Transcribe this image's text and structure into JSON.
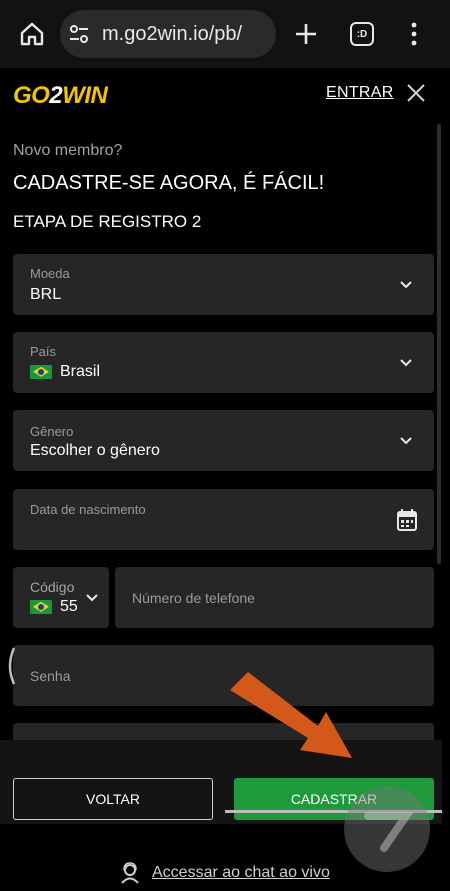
{
  "browser": {
    "url": "m.go2win.io/pb/",
    "tabs_label": ":D"
  },
  "header": {
    "logo_part1": "GO",
    "logo_part2": "2",
    "logo_part3": "WIN",
    "login_label": "ENTRAR"
  },
  "form": {
    "new_member": "Novo membro?",
    "signup_title": "CADASTRE-SE AGORA, É FÁCIL!",
    "step_title": "ETAPA DE REGISTRO 2",
    "currency": {
      "label": "Moeda",
      "value": "BRL"
    },
    "country": {
      "label": "País",
      "value": "Brasil"
    },
    "gender": {
      "label": "Gênero",
      "value": "Escolher o gênero"
    },
    "birthdate": {
      "label": "Data de nascimento"
    },
    "phone_code": {
      "label": "Código",
      "value": "55"
    },
    "phone": {
      "placeholder": "Número de telefone"
    },
    "password": {
      "label": "Senha"
    }
  },
  "actions": {
    "back_label": "VOLTAR",
    "submit_label": "CADASTRAR",
    "chat_label": "Accessar ao chat ao vivo"
  },
  "colors": {
    "accent_yellow": "#f5c400",
    "submit_green": "#1e9a3a",
    "field_bg": "#262626",
    "arrow_orange": "#d4581a"
  }
}
